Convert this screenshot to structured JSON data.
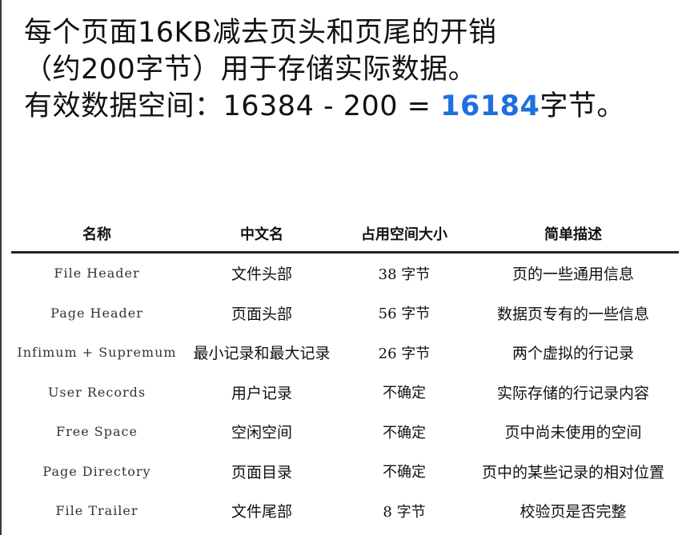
{
  "intro": {
    "line1": "每个页面16KB减去页头和页尾的开销",
    "line2": "（约200字节）用于存储实际数据。",
    "line3_prefix": "有效数据空间：16384 - 200 = ",
    "line3_highlight": "16184",
    "line3_suffix": "字节。",
    "highlight_color": "#1f6fde"
  },
  "table": {
    "headers": {
      "name": "名称",
      "chinese_name": "中文名",
      "size": "占用空间大小",
      "description": "简单描述"
    },
    "rows": [
      {
        "name": "File Header",
        "chinese_name": "文件头部",
        "size": "38 字节",
        "description": "页的一些通用信息"
      },
      {
        "name": "Page Header",
        "chinese_name": "页面头部",
        "size": "56 字节",
        "description": "数据页专有的一些信息"
      },
      {
        "name": "Infimum + Supremum",
        "chinese_name": "最小记录和最大记录",
        "size": "26 字节",
        "description": "两个虚拟的行记录"
      },
      {
        "name": "User Records",
        "chinese_name": "用户记录",
        "size": "不确定",
        "description": "实际存储的行记录内容"
      },
      {
        "name": "Free Space",
        "chinese_name": "空闲空间",
        "size": "不确定",
        "description": "页中尚未使用的空间"
      },
      {
        "name": "Page Directory",
        "chinese_name": "页面目录",
        "size": "不确定",
        "description": "页中的某些记录的相对位置"
      },
      {
        "name": "File Trailer",
        "chinese_name": "文件尾部",
        "size": "8 字节",
        "description": "校验页是否完整"
      }
    ]
  }
}
